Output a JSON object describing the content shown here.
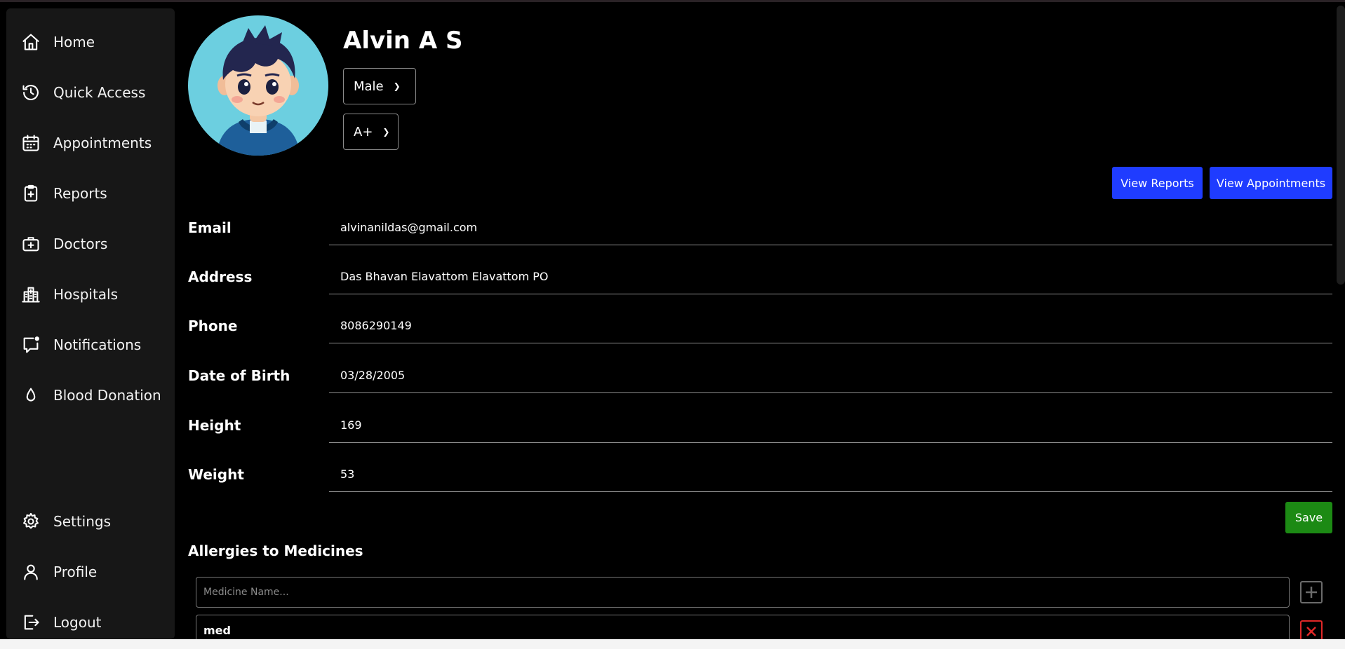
{
  "sidebar": {
    "items": [
      {
        "label": "Home",
        "icon": "home-icon"
      },
      {
        "label": "Quick Access",
        "icon": "history-icon"
      },
      {
        "label": "Appointments",
        "icon": "calendar-icon"
      },
      {
        "label": "Reports",
        "icon": "clipboard-plus-icon"
      },
      {
        "label": "Doctors",
        "icon": "medical-briefcase-icon"
      },
      {
        "label": "Hospitals",
        "icon": "hospital-building-icon"
      },
      {
        "label": "Notifications",
        "icon": "message-notification-icon"
      },
      {
        "label": "Blood Donation",
        "icon": "drop-icon"
      }
    ],
    "bottom_items": [
      {
        "label": "Settings",
        "icon": "gear-icon"
      },
      {
        "label": "Profile",
        "icon": "user-icon"
      },
      {
        "label": "Logout",
        "icon": "logout-icon"
      }
    ]
  },
  "profile": {
    "name": "Alvin A S",
    "gender": "Male",
    "blood_group": "A+"
  },
  "actions": {
    "view_reports": "View Reports",
    "view_appointments": "View Appointments",
    "save": "Save"
  },
  "fields": [
    {
      "label": "Email",
      "value": "alvinanildas@gmail.com"
    },
    {
      "label": "Address",
      "value": "Das Bhavan Elavattom Elavattom PO"
    },
    {
      "label": "Phone",
      "value": "8086290149"
    },
    {
      "label": "Date of Birth",
      "value": "03/28/2005"
    },
    {
      "label": "Height",
      "value": "169"
    },
    {
      "label": "Weight",
      "value": "53"
    }
  ],
  "allergies": {
    "title": "Allergies to Medicines",
    "placeholder": "Medicine Name...",
    "items": [
      "med"
    ]
  },
  "colors": {
    "accent_blue": "#1f3cff",
    "save_green": "#1c8a14",
    "delete_red": "#e02828",
    "sidebar_bg": "#171717"
  }
}
